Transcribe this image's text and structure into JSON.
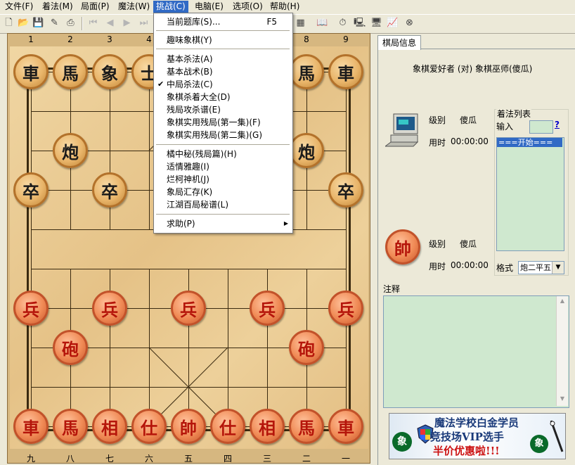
{
  "menubar": {
    "items": [
      "文件(F)",
      "着法(M)",
      "局面(P)",
      "魔法(W)",
      "挑战(C)",
      "电脑(E)",
      "选项(O)",
      "帮助(H)"
    ],
    "active_index": 4
  },
  "dropdown": {
    "items": [
      {
        "label": "当前题库(S)...",
        "shortcut": "F5"
      },
      {
        "label": "趣味象棋(Y)"
      },
      {
        "label": "基本杀法(A)"
      },
      {
        "label": "基本战术(B)"
      },
      {
        "label": "中局杀法(C)",
        "checked": true
      },
      {
        "label": "象棋杀着大全(D)"
      },
      {
        "label": "残局攻杀谱(E)"
      },
      {
        "label": "象棋实用残局(第一集)(F)"
      },
      {
        "label": "象棋实用残局(第二集)(G)"
      },
      {
        "label": "橘中秘(残局篇)(H)"
      },
      {
        "label": "适情雅趣(I)"
      },
      {
        "label": "烂柯神机(J)"
      },
      {
        "label": "象局汇存(K)"
      },
      {
        "label": "江湖百局秘谱(L)"
      },
      {
        "label": "求助(P)",
        "submenu": true
      }
    ],
    "check_mark": "✔",
    "submenu_arrow": "▶"
  },
  "board": {
    "top_labels": [
      "1",
      "2",
      "3",
      "4",
      "5",
      "6",
      "7",
      "8",
      "9"
    ],
    "bottom_labels": [
      "九",
      "八",
      "七",
      "六",
      "五",
      "四",
      "三",
      "二",
      "一"
    ],
    "pieces": [
      {
        "t": "車",
        "side": "black",
        "file": 1,
        "rank": 0
      },
      {
        "t": "馬",
        "side": "black",
        "file": 2,
        "rank": 0
      },
      {
        "t": "象",
        "side": "black",
        "file": 3,
        "rank": 0
      },
      {
        "t": "士",
        "side": "black",
        "file": 4,
        "rank": 0
      },
      {
        "t": "馬",
        "side": "black",
        "file": 8,
        "rank": 0
      },
      {
        "t": "車",
        "side": "black",
        "file": 9,
        "rank": 0
      },
      {
        "t": "炮",
        "side": "black",
        "file": 2,
        "rank": 2
      },
      {
        "t": "炮",
        "side": "black",
        "file": 8,
        "rank": 2
      },
      {
        "t": "卒",
        "side": "black",
        "file": 1,
        "rank": 3
      },
      {
        "t": "卒",
        "side": "black",
        "file": 3,
        "rank": 3
      },
      {
        "t": "卒",
        "side": "black",
        "file": 9,
        "rank": 3
      },
      {
        "t": "兵",
        "side": "red",
        "file": 1,
        "rank": 6
      },
      {
        "t": "兵",
        "side": "red",
        "file": 3,
        "rank": 6
      },
      {
        "t": "兵",
        "side": "red",
        "file": 5,
        "rank": 6
      },
      {
        "t": "兵",
        "side": "red",
        "file": 7,
        "rank": 6
      },
      {
        "t": "兵",
        "side": "red",
        "file": 9,
        "rank": 6
      },
      {
        "t": "砲",
        "side": "red",
        "file": 2,
        "rank": 7
      },
      {
        "t": "砲",
        "side": "red",
        "file": 8,
        "rank": 7
      },
      {
        "t": "車",
        "side": "red",
        "file": 1,
        "rank": 9
      },
      {
        "t": "馬",
        "side": "red",
        "file": 2,
        "rank": 9
      },
      {
        "t": "相",
        "side": "red",
        "file": 3,
        "rank": 9
      },
      {
        "t": "仕",
        "side": "red",
        "file": 4,
        "rank": 9
      },
      {
        "t": "帥",
        "side": "red",
        "file": 5,
        "rank": 9
      },
      {
        "t": "仕",
        "side": "red",
        "file": 6,
        "rank": 9
      },
      {
        "t": "相",
        "side": "red",
        "file": 7,
        "rank": 9
      },
      {
        "t": "馬",
        "side": "red",
        "file": 8,
        "rank": 9
      },
      {
        "t": "車",
        "side": "red",
        "file": 9,
        "rank": 9
      }
    ]
  },
  "panel": {
    "tab_label": "棋局信息",
    "matchup": "象棋爱好者 (对) 象棋巫师(傻瓜)",
    "top_player": {
      "level_label": "级别",
      "level_value": "傻瓜",
      "time_label": "用时",
      "time_value": "00:00:00"
    },
    "bottom_player": {
      "level_label": "级别",
      "level_value": "傻瓜",
      "time_label": "用时",
      "time_value": "00:00:00",
      "piece": "帥"
    },
    "moves": {
      "group_label": "着法列表",
      "input_label": "输入",
      "help": "?",
      "start": "===开始===",
      "format_label": "格式",
      "format_value": "炮二平五"
    },
    "notes_label": "注释",
    "banner": {
      "line1": "魔法学校白金学员",
      "line2": "竞技场VIP选手",
      "line3": "半价优惠啦!!!",
      "badge": "象"
    }
  },
  "colors": {
    "menu_highlight": "#316ac5",
    "list_bg": "#cfe8cf",
    "red_piece": "#b5150a"
  }
}
